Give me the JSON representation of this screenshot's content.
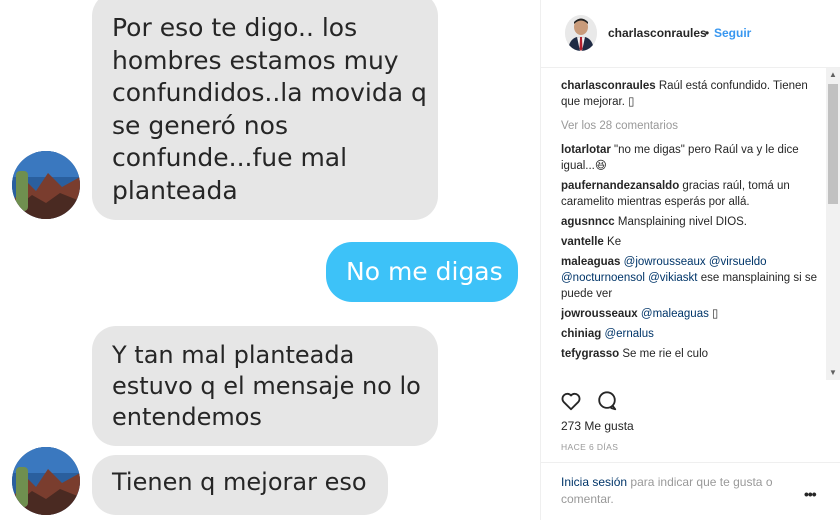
{
  "chat": {
    "messages": [
      {
        "from": "them",
        "lines": [
          "Por eso te digo.. los",
          "hombres estamos muy",
          "confundidos..la movida q",
          "se generó nos",
          "confunde...fue mal",
          "planteada"
        ]
      },
      {
        "from": "me",
        "lines": [
          "No me digas"
        ]
      },
      {
        "from": "them",
        "lines": [
          "Y tan mal planteada",
          "estuvo q el mensaje no lo",
          "entendemos"
        ]
      },
      {
        "from": "them",
        "lines": [
          "Tienen q mejorar eso"
        ]
      }
    ]
  },
  "post": {
    "header": {
      "username": "charlasconraules",
      "separator": "•",
      "follow_label": "Seguir"
    },
    "caption": {
      "user": "charlasconraules",
      "text": "Raúl está confundido. Tienen que mejorar. ▯"
    },
    "view_all_label": "Ver los 28 comentarios",
    "comments": [
      {
        "user": "lotarlotar",
        "text": "\"no me digas\" pero Raúl va y le dice igual...😆"
      },
      {
        "user": "paufernandezansaldo",
        "text": "gracias raúl, tomá un caramelito mientras esperás por allá."
      },
      {
        "user": "agusnncc",
        "text": "Mansplaining nivel DIOS."
      },
      {
        "user": "vantelle",
        "text": "Ke"
      },
      {
        "user": "maleaguas",
        "mentions": [
          "@jowrousseaux",
          "@virsueldo",
          "@nocturnoensol",
          "@vikiaskt"
        ],
        "text": "ese mansplaining si se puede ver"
      },
      {
        "user": "jowrousseaux",
        "mentions": [
          "@maleaguas"
        ],
        "text": "▯"
      },
      {
        "user": "chiniag",
        "mentions": [
          "@ernalus"
        ],
        "text": ""
      },
      {
        "user": "tefygrasso",
        "text": "Se me rie el culo"
      }
    ],
    "likes_label": "273 Me gusta",
    "time_label": "HACE 6 DÍAS",
    "login_link": "Inicia sesión",
    "login_text": "para indicar que te gusta o comentar.",
    "more_label": "•••"
  },
  "icons": {
    "like": "heart-icon",
    "comment": "comment-icon",
    "more": "more-options-icon"
  },
  "colors": {
    "incoming_bubble": "#e6e6e6",
    "outgoing_bubble": "#3dc2f8",
    "link": "#003569",
    "follow": "#3897f0"
  }
}
